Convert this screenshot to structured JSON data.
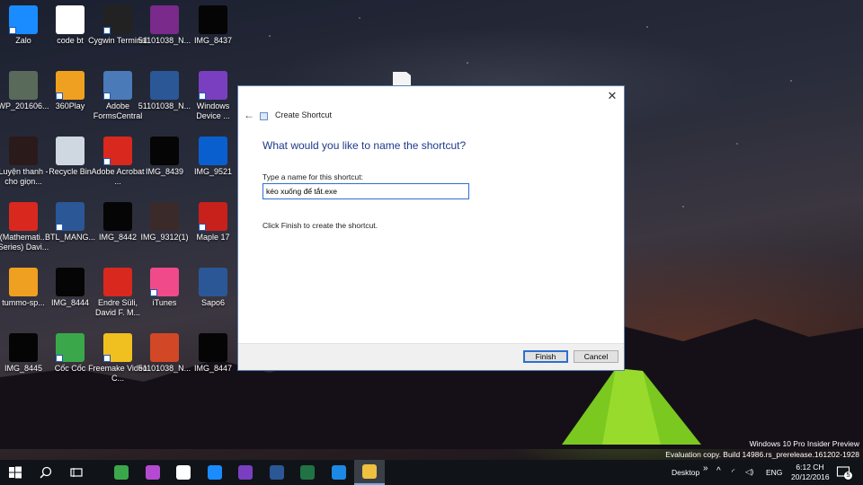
{
  "desktop": {
    "icons": [
      {
        "label": "Zalo",
        "icon": "zalo-icon",
        "color": "#1a8cff",
        "shortcut": true
      },
      {
        "label": "code bt",
        "icon": "text-document-icon",
        "color": "#ffffff",
        "shortcut": false
      },
      {
        "label": "Cygwin Terminal",
        "icon": "terminal-icon",
        "color": "#222222",
        "shortcut": true
      },
      {
        "label": "51101038_N...",
        "icon": "winrar-archive-icon",
        "color": "#7a2a8a",
        "shortcut": false
      },
      {
        "label": "IMG_8437",
        "icon": "image-file-icon",
        "color": "#050505",
        "shortcut": false
      },
      {
        "label": "WP_201606...",
        "icon": "image-file-icon",
        "color": "#5a6a5a",
        "shortcut": false
      },
      {
        "label": "360Play",
        "icon": "360play-icon",
        "color": "#f0a020",
        "shortcut": true
      },
      {
        "label": "Adobe FormsCentral",
        "icon": "adobe-formscentral-icon",
        "color": "#4a7ab8",
        "shortcut": true
      },
      {
        "label": "51101038_N...",
        "icon": "word-document-icon",
        "color": "#2b5797",
        "shortcut": false
      },
      {
        "label": "Windows Device ...",
        "icon": "windows-device-icon",
        "color": "#7a3fc0",
        "shortcut": true
      },
      {
        "label": "Luyện thanh - cho giọn...",
        "icon": "video-file-icon",
        "color": "#2a1a1a",
        "shortcut": false
      },
      {
        "label": "Recycle Bin",
        "icon": "recycle-bin-icon",
        "color": "#cfd8e0",
        "shortcut": false
      },
      {
        "label": "Adobe Acrobat ...",
        "icon": "adobe-acrobat-icon",
        "color": "#d9281e",
        "shortcut": true
      },
      {
        "label": "IMG_8439",
        "icon": "image-file-icon",
        "color": "#050505",
        "shortcut": false
      },
      {
        "label": "IMG_9521",
        "icon": "photoshop-file-icon",
        "color": "#0a5fcf",
        "shortcut": false
      },
      {
        "label": "(Mathemati... Series) Davi...",
        "icon": "pdf-file-icon",
        "color": "#d9281e",
        "shortcut": false
      },
      {
        "label": "BTL_MANG...",
        "icon": "word-document-icon",
        "color": "#2b5797",
        "shortcut": true
      },
      {
        "label": "IMG_8442",
        "icon": "image-file-icon",
        "color": "#050505",
        "shortcut": false
      },
      {
        "label": "IMG_9312(1)",
        "icon": "image-file-icon",
        "color": "#3a2a2a",
        "shortcut": false
      },
      {
        "label": "Maple 17",
        "icon": "maple-icon",
        "color": "#c8201a",
        "shortcut": true
      },
      {
        "label": "tummo-sp...",
        "icon": "flame-icon",
        "color": "#f0a020",
        "shortcut": false
      },
      {
        "label": "IMG_8444",
        "icon": "image-file-icon",
        "color": "#050505",
        "shortcut": false
      },
      {
        "label": "Endre Süli, David F. M...",
        "icon": "pdf-file-icon",
        "color": "#d9281e",
        "shortcut": false
      },
      {
        "label": "iTunes",
        "icon": "itunes-icon",
        "color": "#f04a8a",
        "shortcut": true
      },
      {
        "label": "Sapo6",
        "icon": "word-document-icon",
        "color": "#2b5797",
        "shortcut": false
      },
      {
        "label": "IMG_8445",
        "icon": "image-file-icon",
        "color": "#050505",
        "shortcut": false
      },
      {
        "label": "Cốc Cốc",
        "icon": "coccoc-icon",
        "color": "#3aa84a",
        "shortcut": true
      },
      {
        "label": "Freemake Video C...",
        "icon": "freemake-icon",
        "color": "#f0c020",
        "shortcut": true
      },
      {
        "label": "51101038_N...",
        "icon": "powerpoint-document-icon",
        "color": "#d24726",
        "shortcut": false
      },
      {
        "label": "IMG_8447",
        "icon": "image-file-icon",
        "color": "#050505",
        "shortcut": false
      }
    ]
  },
  "dialog": {
    "title": "Create Shortcut",
    "heading": "What would you like to name the shortcut?",
    "name_label": "Type a name for this shortcut:",
    "name_value": "kéo xuống để tắt.exe",
    "info": "Click Finish to create the shortcut.",
    "finish_label": "Finish",
    "cancel_label": "Cancel"
  },
  "watermark": {
    "line1": "Windows 10 Pro Insider Preview",
    "line2": "Evaluation copy. Build 14986.rs_prerelease.161202-1928"
  },
  "taskbar": {
    "apps": [
      {
        "name": "coccoc-taskbar-icon",
        "color": "#3aa84a"
      },
      {
        "name": "paint-taskbar-icon",
        "color": "#b44ad0"
      },
      {
        "name": "store-taskbar-icon",
        "color": "#ffffff"
      },
      {
        "name": "zalo-taskbar-icon",
        "color": "#1a8cff"
      },
      {
        "name": "visual-studio-taskbar-icon",
        "color": "#7a3fc0"
      },
      {
        "name": "word-taskbar-icon",
        "color": "#2b5797"
      },
      {
        "name": "excel-taskbar-icon",
        "color": "#217346"
      },
      {
        "name": "edge-taskbar-icon",
        "color": "#1e88e5"
      },
      {
        "name": "file-explorer-taskbar-icon",
        "color": "#f0c040"
      }
    ],
    "desktop_label": "Desktop",
    "language": "ENG",
    "time": "6:12 CH",
    "date": "20/12/2016",
    "notification_count": "5"
  }
}
